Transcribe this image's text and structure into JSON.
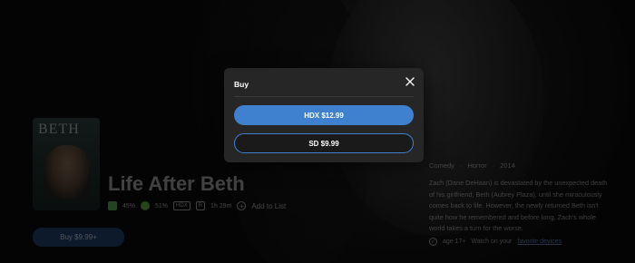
{
  "poster": {
    "title_text": "BETH"
  },
  "movie": {
    "title": "Life After Beth",
    "tomato_score": "45%",
    "popcorn_score": "51%",
    "format_badge": "HDX",
    "rating_badge": "R",
    "runtime": "1h 29m",
    "add_list_label": "Add to List",
    "add_list_icon": "plus-icon",
    "buy_label": "Buy $9.99+",
    "genres": [
      "Comedy",
      "Horror",
      "2014"
    ],
    "synopsis": "Zach (Dane DeHaan) is devastated by the unexpected death of his girlfriend, Beth (Aubrey Plaza), until she miraculously comes back to life. However, the newly returned Beth isn't quite how he remembered and before long, Zach's whole world takes a turn for the worse.",
    "age_label": "age 17+",
    "watch_prefix": "Watch on your",
    "favorite_link": "favorite devices"
  },
  "modal": {
    "title": "Buy",
    "close_icon": "close-icon",
    "options": [
      {
        "label": "HDX $12.99"
      },
      {
        "label": "SD $9.99"
      }
    ]
  },
  "colors": {
    "accent": "#3f81cf",
    "modal_bg": "#262626"
  }
}
